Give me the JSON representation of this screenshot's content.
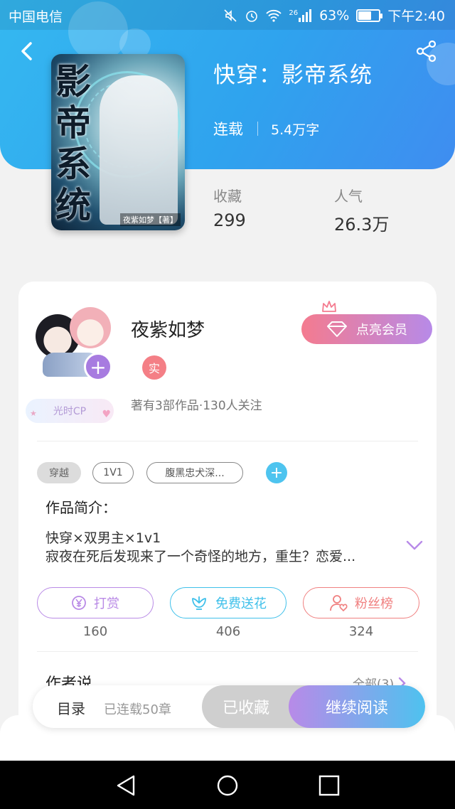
{
  "status_bar": {
    "carrier": "中国电信",
    "network": "26",
    "battery": "63%",
    "battery_level": 0.63,
    "time": "下午2:40"
  },
  "book": {
    "title": "快穿：影帝系统",
    "serial_status": "连载",
    "word_count": "5.4万字",
    "cover_title_chars": [
      "影",
      "帝",
      "系",
      "统"
    ],
    "cover_author_tag": "夜紫如梦【著】"
  },
  "stats": [
    {
      "label": "收藏",
      "value": "299"
    },
    {
      "label": "人气",
      "value": "26.3万"
    }
  ],
  "author": {
    "name": "夜紫如梦",
    "real_badge": "实",
    "cp_badge": "光时CP",
    "meta": "著有3部作品·130人关注",
    "vip_button": "点亮会员"
  },
  "tags": [
    "穿越",
    "1V1",
    "腹黑忠犬深..."
  ],
  "intro": {
    "heading": "作品简介：",
    "line1": "快穿×双男主×1v1",
    "line2": "寂夜在死后发现来了一个奇怪的地方，重生？恋爱..."
  },
  "actions": [
    {
      "label": "打赏",
      "count": "160",
      "color": "#b98ae6",
      "icon": "yen-icon"
    },
    {
      "label": "免费送花",
      "count": "406",
      "color": "#3fc0ea",
      "icon": "flower-icon"
    },
    {
      "label": "粉丝榜",
      "count": "324",
      "color": "#f08080",
      "icon": "fan-icon"
    }
  ],
  "author_say": {
    "heading": "作者说",
    "all_link": "全部(3)"
  },
  "bottom_bar": {
    "toc": "目录",
    "serial_info": "已连载50章",
    "collected": "已收藏",
    "continue_read": "继续阅读"
  },
  "colors": {
    "header_blue": "#35b8f0",
    "accent_purple": "#b88ae8",
    "accent_cyan": "#4ec2ef",
    "vip_pink": "#f47b8f"
  }
}
